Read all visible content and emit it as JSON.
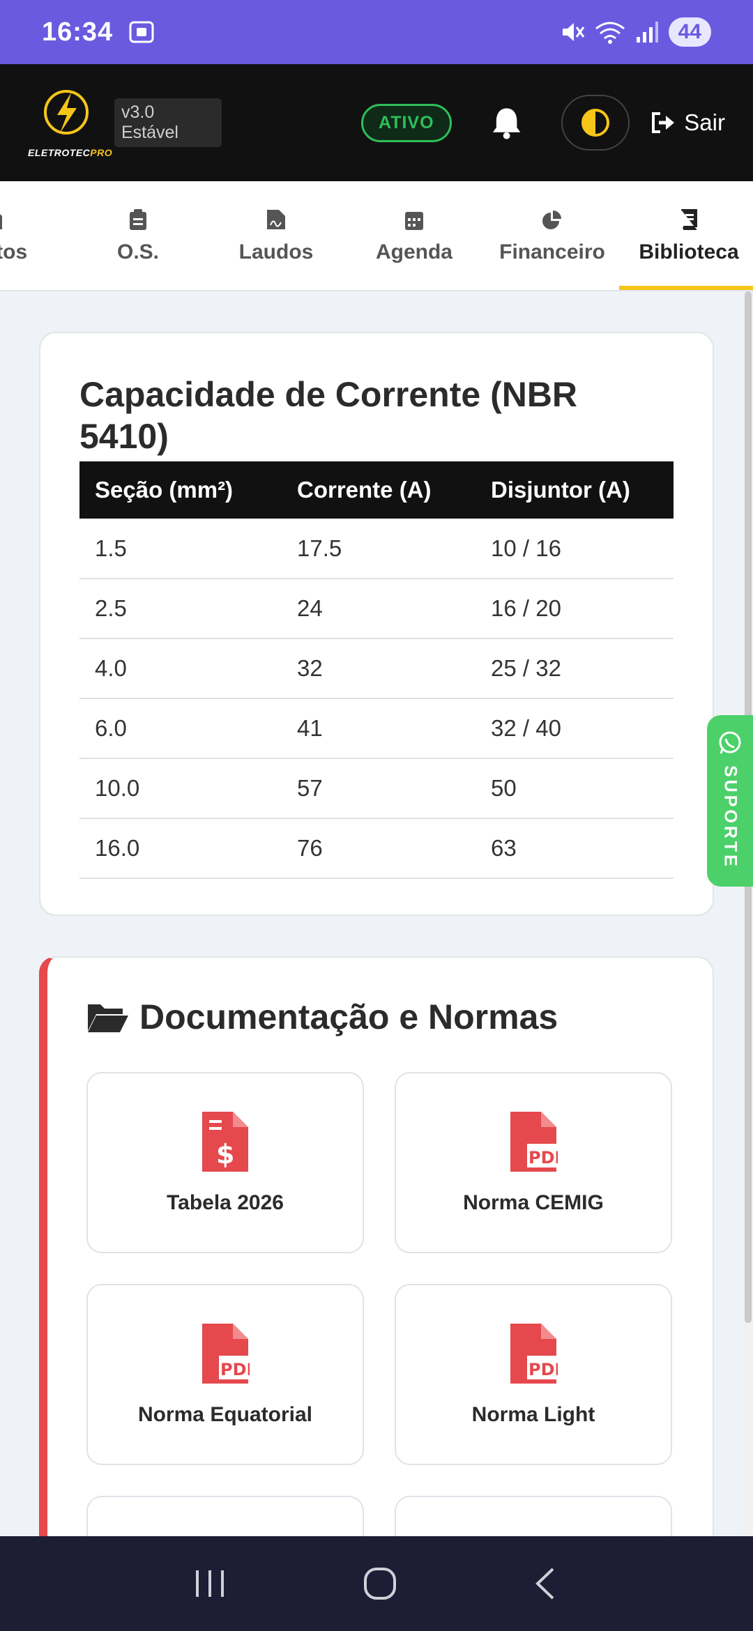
{
  "status_bar": {
    "time": "16:34",
    "battery": "44"
  },
  "header": {
    "logo_text_left": "ELETROTEC",
    "logo_text_right": "PRO",
    "version": "v3.0 Estável",
    "status": "ATIVO",
    "logout_label": "Sair",
    "accent_color": "#f5c518"
  },
  "tabs": [
    {
      "label": "nentos"
    },
    {
      "label": "O.S."
    },
    {
      "label": "Laudos"
    },
    {
      "label": "Agenda"
    },
    {
      "label": "Financeiro"
    },
    {
      "label": "Biblioteca"
    }
  ],
  "ampacity_card": {
    "title": "Capacidade de Corrente (NBR 5410)",
    "headers": [
      "Seção (mm²)",
      "Corrente (A)",
      "Disjuntor (A)"
    ],
    "rows": [
      [
        "1.5",
        "17.5",
        "10 / 16"
      ],
      [
        "2.5",
        "24",
        "16 / 20"
      ],
      [
        "4.0",
        "32",
        "25 / 32"
      ],
      [
        "6.0",
        "41",
        "32 / 40"
      ],
      [
        "10.0",
        "57",
        "50"
      ],
      [
        "16.0",
        "76",
        "63"
      ]
    ]
  },
  "docs_card": {
    "title": "Documentação e Normas",
    "items": [
      {
        "label": "Tabela 2026",
        "icon": "file-invoice-dollar-icon"
      },
      {
        "label": "Norma CEMIG",
        "icon": "file-pdf-icon"
      },
      {
        "label": "Norma Equatorial",
        "icon": "file-pdf-icon"
      },
      {
        "label": "Norma Light",
        "icon": "file-pdf-icon"
      }
    ]
  },
  "support": {
    "label": "SUPORTE"
  }
}
